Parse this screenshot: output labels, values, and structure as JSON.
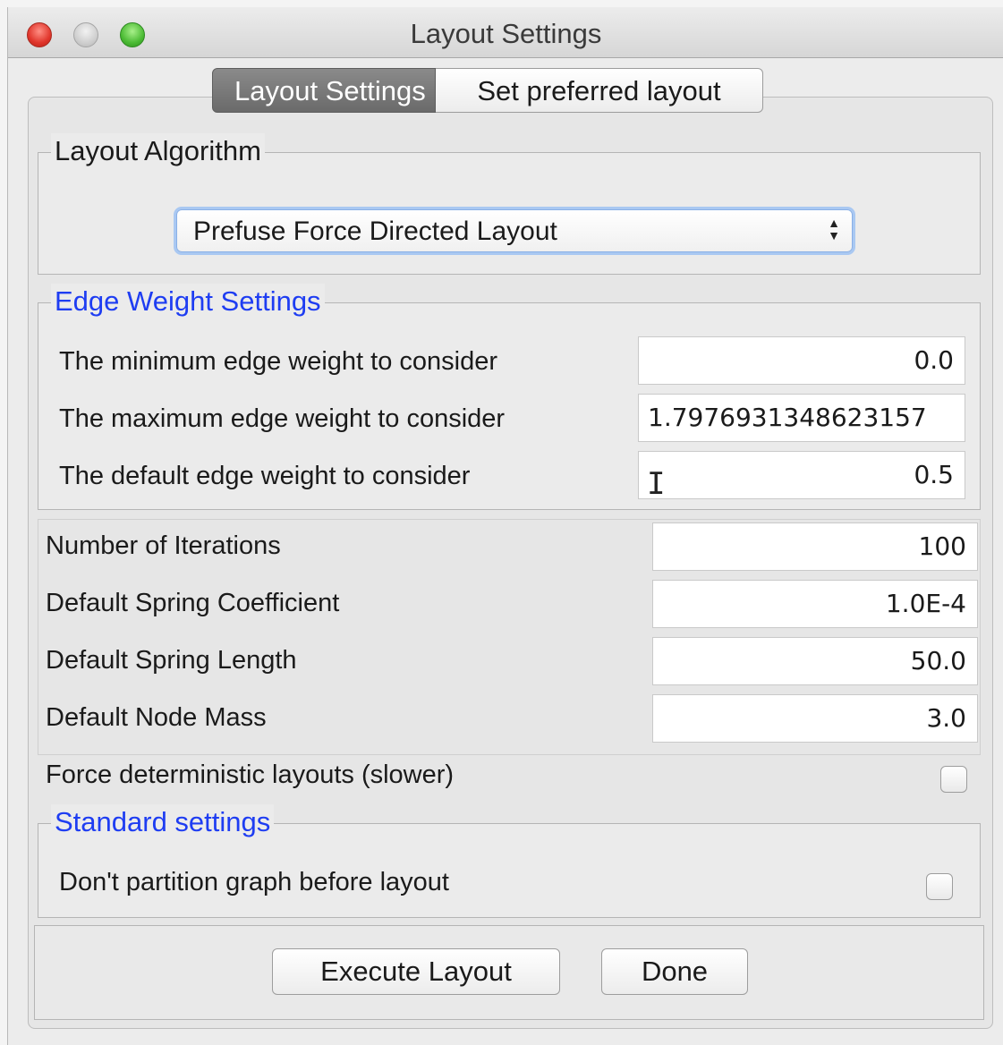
{
  "window": {
    "title": "Layout Settings"
  },
  "tabs": [
    {
      "label": "Layout Settings",
      "active": true
    },
    {
      "label": "Set preferred layout",
      "active": false
    }
  ],
  "layout_algorithm": {
    "legend": "Layout Algorithm",
    "selected": "Prefuse Force Directed Layout"
  },
  "edge_weight": {
    "legend": "Edge Weight Settings",
    "rows": [
      {
        "label": "The minimum edge weight to consider",
        "value": "0.0"
      },
      {
        "label": "The maximum edge weight to consider",
        "value": "1.7976931348623157"
      },
      {
        "label": "The default edge weight to consider",
        "value": "0.5"
      }
    ]
  },
  "params": [
    {
      "label": "Number of Iterations",
      "value": "100"
    },
    {
      "label": "Default Spring Coefficient",
      "value": "1.0E-4"
    },
    {
      "label": "Default Spring Length",
      "value": "50.0"
    },
    {
      "label": "Default Node Mass",
      "value": "3.0"
    }
  ],
  "deterministic": {
    "label": "Force deterministic layouts (slower)",
    "checked": false
  },
  "standard": {
    "legend": "Standard settings",
    "partition_label": "Don't partition graph before layout",
    "checked": false
  },
  "buttons": {
    "execute": "Execute Layout",
    "done": "Done"
  },
  "colors": {
    "accent_blue": "#1e3df2",
    "focus_ring": "#a9c8f2"
  }
}
